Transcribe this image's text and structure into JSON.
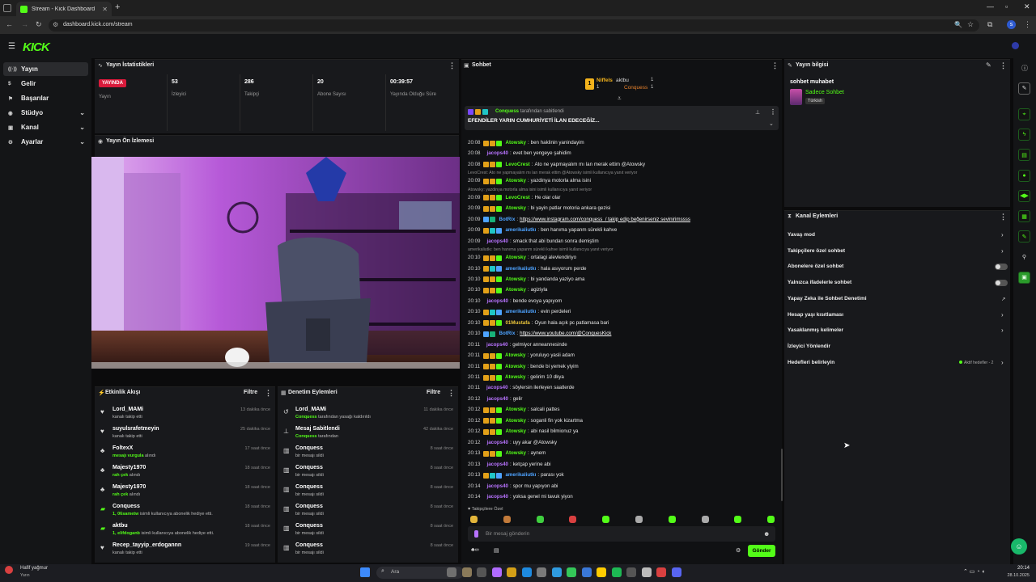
{
  "browser": {
    "tab_title": "Stream - Kick Dashboard",
    "url": "dashboard.kick.com/stream",
    "avatar_letter": "s"
  },
  "app": {
    "logo": "KICK"
  },
  "nav": [
    {
      "label": "Yayın",
      "selected": true
    },
    {
      "label": "Gelir"
    },
    {
      "label": "Başarılar"
    },
    {
      "label": "Stüdyo",
      "expandable": true
    },
    {
      "label": "Kanal",
      "expandable": true
    },
    {
      "label": "Ayarlar",
      "expandable": true
    }
  ],
  "stats": {
    "title": "Yayın İstatistikleri",
    "live_badge": "YAYINDA",
    "live_label": "Yayın",
    "items": [
      {
        "value": "53",
        "label": "İzleyici"
      },
      {
        "value": "286",
        "label": "Takipçi"
      },
      {
        "value": "20",
        "label": "Abone Sayısı"
      },
      {
        "value": "00:39:57",
        "label": "Yayında Olduğu Süre"
      }
    ]
  },
  "preview": {
    "title": "Yayın Ön İzlemesi"
  },
  "activity": {
    "title": "Etkinlik Akışı",
    "filter": "Filtre",
    "items": [
      {
        "icon": "heart-icon",
        "name": "Lord_MAMi",
        "pre": "",
        "sub": "kanalı takip etti",
        "time": "13 dakika önce"
      },
      {
        "icon": "heart-icon",
        "name": "suyulsrafetmeyin",
        "pre": "",
        "sub": "kanalı takip etti",
        "time": "25 dakika önce"
      },
      {
        "icon": "kicks-icon",
        "name": "FoltexX",
        "pre": "mesajı vurgula",
        "sub": " alındı",
        "time": "17 saat önce"
      },
      {
        "icon": "kicks-icon",
        "name": "Majesty1970",
        "pre": "rah çek",
        "sub": " alındı",
        "time": "18 saat önce"
      },
      {
        "icon": "kicks-icon",
        "name": "Majesty1970",
        "pre": "rah çek",
        "sub": " alındı",
        "time": "18 saat önce"
      },
      {
        "icon": "gift-icon",
        "name": "Conquess",
        "pre": "1, 06sametw",
        "sub": " isimli kullanıcıya abonelik hediye etti.",
        "time": "18 saat önce"
      },
      {
        "icon": "gift-icon",
        "name": "aktbu",
        "pre": "1, elifdoganb",
        "sub": " isimli kullanıcıya abonelik hediye etti.",
        "time": "18 saat önce"
      },
      {
        "icon": "heart-icon",
        "name": "Recep_tayyip_erdogannn",
        "pre": "",
        "sub": "kanalı takip etti",
        "time": "19 saat önce"
      }
    ]
  },
  "moderation": {
    "title": "Denetim Eylemleri",
    "filter": "Filtre",
    "items": [
      {
        "icon": "undo-icon",
        "name": "Lord_MAMi",
        "pre": "Conquess",
        "sub": " tarafından yasağı kaldırıldı",
        "time": "11 dakika önce"
      },
      {
        "icon": "pin-icon",
        "name": "Mesaj Sabitlendi",
        "pre": "Conquess",
        "sub": " tarafından",
        "time": "42 dakika önce"
      },
      {
        "icon": "trash-icon",
        "name": "Conquess",
        "pre": "",
        "sub": "bir mesajı sildi",
        "time": "8 saat önce"
      },
      {
        "icon": "trash-icon",
        "name": "Conquess",
        "pre": "",
        "sub": "bir mesajı sildi",
        "time": "8 saat önce"
      },
      {
        "icon": "trash-icon",
        "name": "Conquess",
        "pre": "",
        "sub": "bir mesajı sildi",
        "time": "8 saat önce"
      },
      {
        "icon": "trash-icon",
        "name": "Conquess",
        "pre": "",
        "sub": "bir mesajı sildi",
        "time": "8 saat önce"
      },
      {
        "icon": "trash-icon",
        "name": "Conquess",
        "pre": "",
        "sub": "bir mesajı sildi",
        "time": "8 saat önce"
      },
      {
        "icon": "trash-icon",
        "name": "Conquess",
        "pre": "",
        "sub": "bir mesajı sildi",
        "time": "8 saat önce"
      }
    ]
  },
  "chat": {
    "title": "Sohbet",
    "leaders": {
      "first": {
        "name": "Niffels",
        "count": "1"
      },
      "second": [
        {
          "name": "aktbu",
          "count": "1"
        },
        {
          "name": "Conquess",
          "count": "1"
        }
      ]
    },
    "pinned": {
      "user": "Conquess",
      "by": "tarafından sabitlendi",
      "text": "EFENDİLER YARIN CUMHURİYETİ İLAN EDECEĞİZ..."
    },
    "messages": [
      {
        "type": "msg",
        "time": "20:08",
        "user": "Atowsky",
        "color": "green",
        "text": "ben haklinin yanindayim"
      },
      {
        "type": "msg",
        "time": "20:08",
        "user": "jacops40",
        "color": "purple",
        "text": "evet ben yengeye şahidim"
      },
      {
        "type": "msg",
        "time": "20:08",
        "user": "LevoCrest",
        "color": "green",
        "text": "Ato ne yapmayalım mı lan merak ettim @Atowsky"
      },
      {
        "type": "reply",
        "text": "LevoCrest: Ato ne yapmayalım mı lan merak ettim @Atowsky isimli kullanıcıya yanıt veriyor"
      },
      {
        "type": "msg",
        "time": "20:09",
        "user": "Atowsky",
        "color": "green",
        "text": "yazdinya motorla alma isini"
      },
      {
        "type": "reply",
        "text": "Atowsky: yazdinya motorla alma isini isimli kullanıcıya yanıt veriyor"
      },
      {
        "type": "msg",
        "time": "20:09",
        "user": "LevoCrest",
        "color": "green",
        "text": "He olar olar"
      },
      {
        "type": "msg",
        "time": "20:09",
        "user": "Atowsky",
        "color": "green",
        "text": "bi yayin patlar motoria ankara gezisi"
      },
      {
        "type": "msg",
        "time": "20:09",
        "user": "BotRix",
        "color": "blue",
        "text": "https://www.instagram.com/conquess_/ takip edip beğenirseniz sevinirimssss",
        "link": true
      },
      {
        "type": "msg",
        "time": "20:09",
        "user": "amerikaliutkı",
        "color": "blue",
        "text": "ben hanıma yapanm sürekli kahve"
      },
      {
        "type": "msg",
        "time": "20:09",
        "user": "jacops40",
        "color": "purple",
        "text": "smack that abi bundan sonra demiştim"
      },
      {
        "type": "reply",
        "text": "amerikaliutkı: ben hanıma yapanm sürekli kahve isimli kullanıcıya yanıt veriyor"
      },
      {
        "type": "msg",
        "time": "20:10",
        "user": "Atowsky",
        "color": "green",
        "text": "ortalagi alevlendiriyo"
      },
      {
        "type": "msg",
        "time": "20:10",
        "user": "amerikaliutkı",
        "color": "blue",
        "text": "hala asıyorum perde"
      },
      {
        "type": "msg",
        "time": "20:10",
        "user": "Atowsky",
        "color": "green",
        "text": "bi yandanda yaziyo ama"
      },
      {
        "type": "msg",
        "time": "20:10",
        "user": "Atowsky",
        "color": "green",
        "text": "agiziyla"
      },
      {
        "type": "msg",
        "time": "20:10",
        "user": "jacops40",
        "color": "purple",
        "text": "bende evoya yapıyom"
      },
      {
        "type": "msg",
        "time": "20:10",
        "user": "amerikaliutkı",
        "color": "blue",
        "text": "evin perdeleri"
      },
      {
        "type": "msg",
        "time": "20:10",
        "user": "01Mustafa",
        "color": "yellow",
        "text": "Oyun hala açık pc patlamasa bari"
      },
      {
        "type": "msg",
        "time": "20:10",
        "user": "BotRix",
        "color": "blue",
        "text": "https://www.youtube.com/@ConquesKick",
        "link": true
      },
      {
        "type": "msg",
        "time": "20:11",
        "user": "jacops40",
        "color": "purple",
        "text": "gelmiyor anneannesinde"
      },
      {
        "type": "msg",
        "time": "20:11",
        "user": "Atowsky",
        "color": "green",
        "text": "yoruluyo yasli adam"
      },
      {
        "type": "msg",
        "time": "20:11",
        "user": "Atowsky",
        "color": "green",
        "text": "bende bi yemek yiyim"
      },
      {
        "type": "msg",
        "time": "20:11",
        "user": "Atowsky",
        "color": "green",
        "text": "gelirim 10 dkya"
      },
      {
        "type": "msg",
        "time": "20:11",
        "user": "jacops40",
        "color": "purple",
        "text": "söylersin ilerleyen saatlerde"
      },
      {
        "type": "msg",
        "time": "20:12",
        "user": "jacops40",
        "color": "purple",
        "text": "gelir"
      },
      {
        "type": "msg",
        "time": "20:12",
        "user": "Atowsky",
        "color": "green",
        "text": "salcali pattes"
      },
      {
        "type": "msg",
        "time": "20:12",
        "user": "Atowsky",
        "color": "green",
        "text": "soganli fin yok kizartma"
      },
      {
        "type": "msg",
        "time": "20:12",
        "user": "Atowsky",
        "color": "green",
        "text": "abi nasil bilmionuz ya"
      },
      {
        "type": "msg",
        "time": "20:12",
        "user": "jacops40",
        "color": "purple",
        "text": "uyy akar @Atowsky"
      },
      {
        "type": "msg",
        "time": "20:13",
        "user": "Atowsky",
        "color": "green",
        "text": "aynem"
      },
      {
        "type": "msg",
        "time": "20:13",
        "user": "jacops40",
        "color": "purple",
        "text": "ketçap yerine abi"
      },
      {
        "type": "msg",
        "time": "20:13",
        "user": "amerikaliutkı",
        "color": "blue",
        "text": "parası yok"
      },
      {
        "type": "msg",
        "time": "20:14",
        "user": "jacops40",
        "color": "purple",
        "text": "spor mu yapıyon abi"
      },
      {
        "type": "msg",
        "time": "20:14",
        "user": "jacops40",
        "color": "purple",
        "text": "yoksa genel mi tavuk yiyon"
      }
    ],
    "followers_only": "Takipçilere Özel",
    "input_placeholder": "Bir mesaj gönderin",
    "send": "Gönder"
  },
  "stream_info": {
    "title": "Yayın bilgisi",
    "stream_title": "sohbet muhabet",
    "category": "Sadece Sohbet",
    "language": "Türkish"
  },
  "channel_actions": {
    "title": "Kanal Eylemleri",
    "items": [
      {
        "label": "Yavaş mod",
        "control": "chevron"
      },
      {
        "label": "Takipçilere özel sohbet",
        "control": "chevron"
      },
      {
        "label": "Abonelere özel sohbet",
        "control": "toggle"
      },
      {
        "label": "Yalnızca ifadelerle sohbet",
        "control": "toggle"
      },
      {
        "label": "Yapay Zeka ile Sohbet Denetimi",
        "control": "external"
      },
      {
        "label": "Hesap yaşı kısıtlaması",
        "control": "chevron"
      },
      {
        "label": "Yasaklanmış kelimeler",
        "control": "chevron"
      },
      {
        "label": "İzleyici Yönlendir",
        "control": "none"
      },
      {
        "label": "Hedefleri belirleyin",
        "control": "chevron",
        "badge": "Aktif hedefler - 2"
      }
    ]
  },
  "taskbar": {
    "weather": "Hafif yağmur",
    "weather_sub": "Yarın",
    "search": "Ara",
    "time": "20:14",
    "date": "28.10.2025"
  },
  "colors": {
    "accent": "#53fc18",
    "live": "#d91a3b",
    "purple": "#b873ff",
    "blue": "#4ea3ff"
  }
}
